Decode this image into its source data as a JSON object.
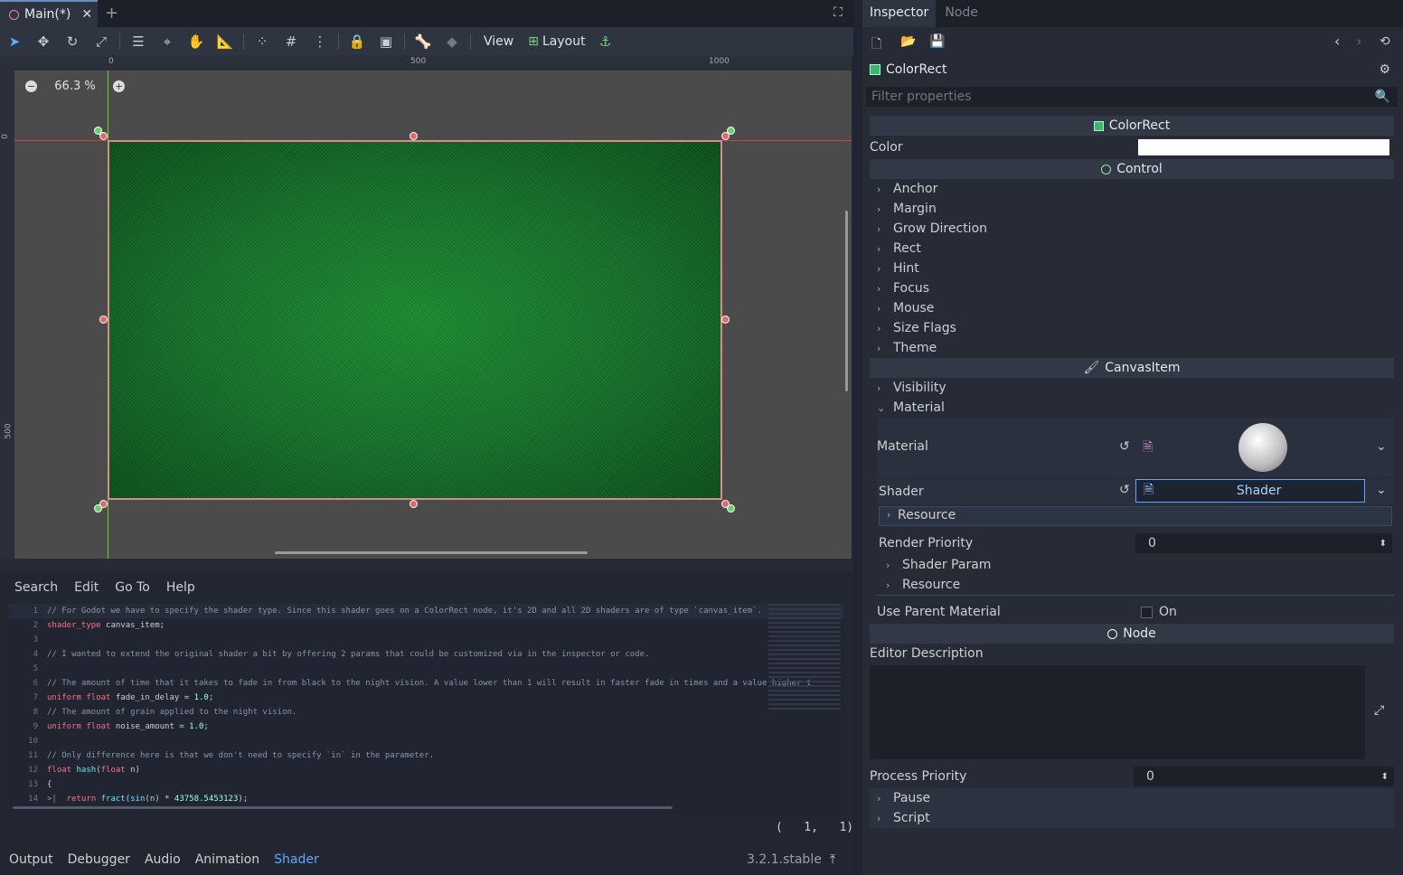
{
  "scene_tab": {
    "label": "Main(*)"
  },
  "toolbar": {
    "view_label": "View",
    "layout_label": "Layout"
  },
  "viewport": {
    "zoom": "66.3 %",
    "ruler_x": [
      "0",
      "500",
      "1000"
    ],
    "ruler_y": [
      "0",
      "500"
    ]
  },
  "script_menu": [
    "Search",
    "Edit",
    "Go To",
    "Help"
  ],
  "code_lines": [
    {
      "n": "1",
      "parts": [
        [
          "cm",
          "// For Godot we have to specify the shader type. Since this shader goes on a ColorRect node, it's 2D and all 2D shaders are of type `canvas_item`."
        ]
      ]
    },
    {
      "n": "2",
      "parts": [
        [
          "kw",
          "shader_type"
        ],
        [
          "tx",
          " canvas_item;"
        ]
      ]
    },
    {
      "n": "3",
      "parts": []
    },
    {
      "n": "4",
      "parts": [
        [
          "cm",
          "// I wanted to extend the original shader a bit by offering 2 params that could be customized via in the inspector or code."
        ]
      ]
    },
    {
      "n": "5",
      "parts": []
    },
    {
      "n": "6",
      "parts": [
        [
          "cm",
          "// The amount of time that it takes to fade in from black to the night vision. A value lower than 1 will result in faster fade in times and a value higher t"
        ]
      ]
    },
    {
      "n": "7",
      "parts": [
        [
          "kw",
          "uniform"
        ],
        [
          "tx",
          " "
        ],
        [
          "kw",
          "float"
        ],
        [
          "tx",
          " fade_in_delay = "
        ],
        [
          "nm",
          "1.0"
        ],
        [
          "tx",
          ";"
        ]
      ]
    },
    {
      "n": "8",
      "parts": [
        [
          "cm",
          "// The amount of grain applied to the night vision."
        ]
      ]
    },
    {
      "n": "9",
      "parts": [
        [
          "kw",
          "uniform"
        ],
        [
          "tx",
          " "
        ],
        [
          "kw",
          "float"
        ],
        [
          "tx",
          " noise_amount = "
        ],
        [
          "nm",
          "1.0"
        ],
        [
          "tx",
          ";"
        ]
      ]
    },
    {
      "n": "10",
      "parts": []
    },
    {
      "n": "11",
      "parts": [
        [
          "cm",
          "// Only difference here is that we don't need to specify `in` in the parameter."
        ]
      ]
    },
    {
      "n": "12",
      "parts": [
        [
          "kw",
          "float"
        ],
        [
          "tx",
          " "
        ],
        [
          "fn",
          "hash"
        ],
        [
          "tx",
          "("
        ],
        [
          "kw",
          "float"
        ],
        [
          "tx",
          " n)"
        ]
      ]
    },
    {
      "n": "13",
      "parts": [
        [
          "tx",
          "{"
        ]
      ]
    },
    {
      "n": "14",
      "parts": [
        [
          "cm",
          ">|  "
        ],
        [
          "kw",
          "return"
        ],
        [
          "tx",
          " "
        ],
        [
          "fn",
          "fract"
        ],
        [
          "tx",
          "("
        ],
        [
          "fn",
          "sin"
        ],
        [
          "tx",
          "(n) * "
        ],
        [
          "nm",
          "43758.5453123"
        ],
        [
          "tx",
          ");"
        ]
      ]
    }
  ],
  "cursor_pos": "(   1,   1)",
  "bottom_tabs": [
    "Output",
    "Debugger",
    "Audio",
    "Animation",
    "Shader"
  ],
  "version": "3.2.1.stable",
  "inspector": {
    "tabs": [
      "Inspector",
      "Node"
    ],
    "object_name": "ColorRect",
    "filter_placeholder": "Filter properties",
    "sections": {
      "colorrect": "ColorRect",
      "control": "Control",
      "canvasitem": "CanvasItem",
      "node": "Node"
    },
    "color_label": "Color",
    "color_value": "#ffffff",
    "control_cats": [
      "Anchor",
      "Margin",
      "Grow Direction",
      "Rect",
      "Hint",
      "Focus",
      "Mouse",
      "Size Flags",
      "Theme"
    ],
    "visibility": "Visibility",
    "material_cat": "Material",
    "material_label": "Material",
    "shader_label": "Shader",
    "shader_value": "Shader",
    "resource": "Resource",
    "render_priority_label": "Render Priority",
    "render_priority_value": "0",
    "shader_param": "Shader Param",
    "use_parent_label": "Use Parent Material",
    "use_parent_value": "On",
    "editor_desc_label": "Editor Description",
    "process_priority_label": "Process Priority",
    "process_priority_value": "0",
    "pause": "Pause",
    "script": "Script"
  }
}
